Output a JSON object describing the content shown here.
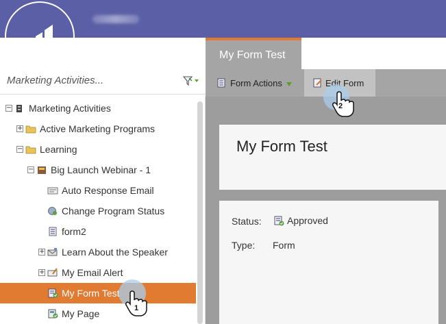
{
  "header": {
    "logo": "marketo-logo-icon"
  },
  "left_panel": {
    "search_label": "Marketing Activities...",
    "filter_icon": "funnel-filter-icon",
    "tree": [
      {
        "label": "Marketing Activities",
        "icon": "folder-root-icon",
        "expander": "minus"
      },
      {
        "label": "Active Marketing Programs",
        "icon": "folder-icon",
        "expander": "plus"
      },
      {
        "label": "Learning",
        "icon": "folder-icon",
        "expander": "minus"
      },
      {
        "label": "Big Launch Webinar - 1",
        "icon": "webinar-program-icon",
        "expander": "minus"
      },
      {
        "label": "Auto Response Email",
        "icon": "email-icon",
        "expander": ""
      },
      {
        "label": "Change Program Status",
        "icon": "smart-campaign-icon",
        "expander": ""
      },
      {
        "label": "form2",
        "icon": "form-icon",
        "expander": ""
      },
      {
        "label": "Learn About the Speaker",
        "icon": "email-program-icon",
        "expander": "plus"
      },
      {
        "label": "My Email Alert",
        "icon": "email-alert-icon",
        "expander": "plus"
      },
      {
        "label": "My Form Test",
        "icon": "form-approved-icon",
        "expander": "",
        "selected": true
      },
      {
        "label": "My Page",
        "icon": "landing-page-icon",
        "expander": ""
      }
    ]
  },
  "right_panel": {
    "tab_label": "My Form Test",
    "toolbar": {
      "form_actions_label": "Form Actions",
      "edit_form_label": "Edit Form"
    },
    "title": "My Form Test",
    "details": {
      "status_label": "Status:",
      "status_value": "Approved",
      "type_label": "Type:",
      "type_value": "Form"
    }
  },
  "annotations": {
    "step1": "1",
    "step2": "2"
  },
  "colors": {
    "header_bg": "#5b5fa5",
    "accent_orange": "#e07b31",
    "toolbar_gray": "#a5a5a5"
  }
}
